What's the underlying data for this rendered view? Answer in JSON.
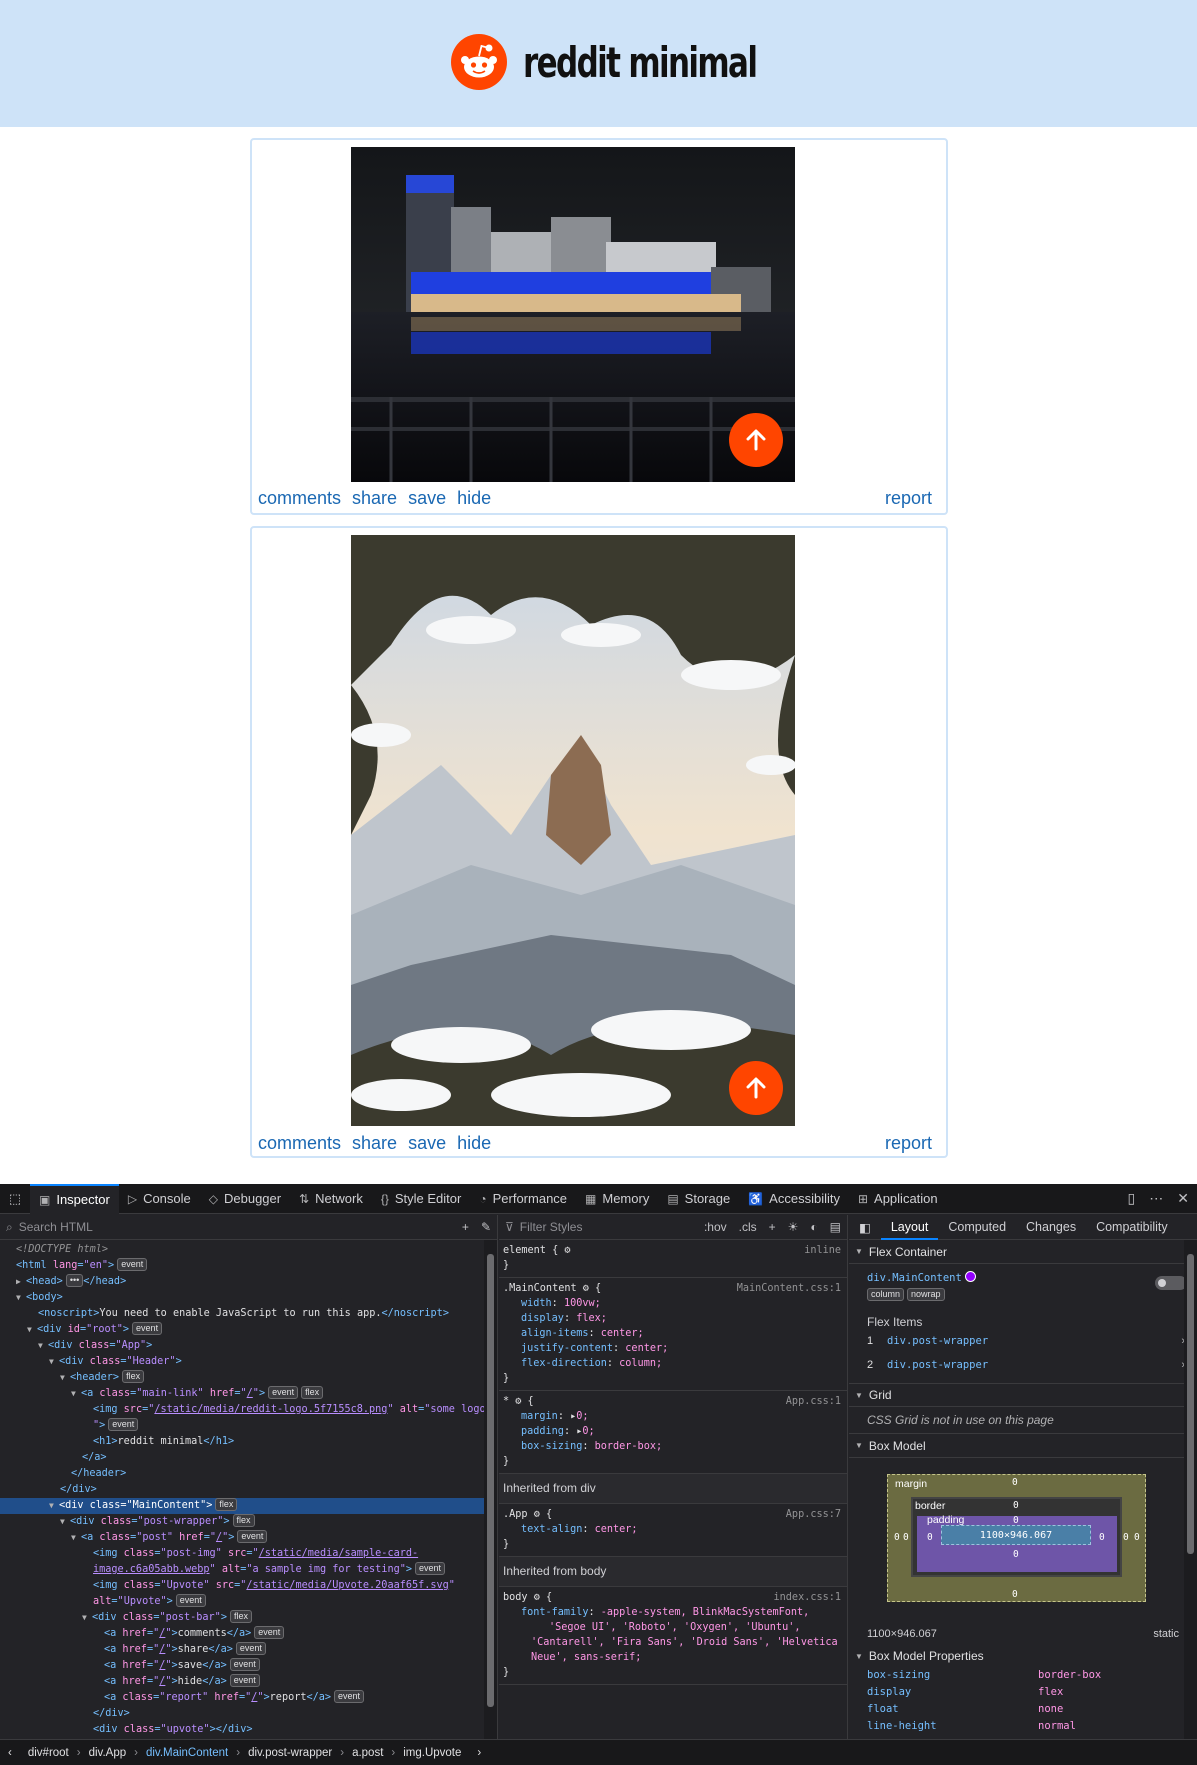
{
  "site": {
    "title": "reddit minimal"
  },
  "posts": [
    {
      "bar": {
        "comments": "comments",
        "share": "share",
        "save": "save",
        "hide": "hide",
        "report": "report"
      }
    },
    {
      "bar": {
        "comments": "comments",
        "share": "share",
        "save": "save",
        "hide": "hide",
        "report": "report"
      }
    }
  ],
  "devtools": {
    "tabs": [
      "Inspector",
      "Console",
      "Debugger",
      "Network",
      "Style Editor",
      "Performance",
      "Memory",
      "Storage",
      "Accessibility",
      "Application"
    ],
    "search_placeholder": "Search HTML",
    "filter_placeholder": "Filter Styles",
    "filter_tools": [
      ":hov",
      ".cls"
    ],
    "html_tree": {
      "doctype": "<!DOCTYPE html>",
      "noscript_text": "You need to enable JavaScript to run this app.",
      "img_logo_src": "/static/media/reddit-logo.5f7155c8.png",
      "img_logo_alt": "some logo",
      "h1_text": "reddit minimal",
      "post_img_src": "/static/media/sample-card-image.c6a05abb.webp",
      "post_img_alt": "a sample img for testing",
      "upvote_src": "/static/media/Upvote.20aaf65f.svg",
      "upvote_alt": "Upvote",
      "links": [
        "comments",
        "share",
        "save",
        "hide"
      ],
      "report": "report"
    },
    "rules": {
      "element": {
        "selector": "element {",
        "src": "inline"
      },
      "main_content": {
        "selector": ".MainContent",
        "src": "MainContent.css:1",
        "decls": [
          {
            "p": "width",
            "v": "100vw;"
          },
          {
            "p": "display",
            "v": "flex;"
          },
          {
            "p": "align-items",
            "v": "center;"
          },
          {
            "p": "justify-content",
            "v": "center;"
          },
          {
            "p": "flex-direction",
            "v": "column;"
          }
        ]
      },
      "star": {
        "selector": "*",
        "src": "App.css:1",
        "decls": [
          {
            "p": "margin",
            "v": "0;"
          },
          {
            "p": "padding",
            "v": "0;"
          },
          {
            "p": "box-sizing",
            "v": "border-box;"
          }
        ]
      },
      "inherited_div": "Inherited from div",
      "app": {
        "selector": ".App",
        "src": "App.css:7",
        "decls": [
          {
            "p": "text-align",
            "v": "center;"
          }
        ]
      },
      "inherited_body": "Inherited from body",
      "body": {
        "selector": "body",
        "src": "index.css:1",
        "font_family_prop": "font-family",
        "font_family_val": "-apple-system, BlinkMacSystemFont,",
        "font_family_val2": "'Segoe UI', 'Roboto', 'Oxygen', 'Ubuntu',",
        "font_family_val3": "'Cantarell', 'Fira Sans', 'Droid Sans', 'Helvetica",
        "font_family_val4": "Neue', sans-serif;"
      }
    },
    "layout": {
      "tabs": [
        "Layout",
        "Computed",
        "Changes",
        "Compatibility"
      ],
      "flex_container": "Flex Container",
      "container_name": "div.MainContent",
      "container_badges": [
        "column",
        "nowrap"
      ],
      "flex_items_title": "Flex Items",
      "flex_items": [
        {
          "n": "1",
          "name": "div.post-wrapper"
        },
        {
          "n": "2",
          "name": "div.post-wrapper"
        }
      ],
      "grid": "Grid",
      "grid_msg": "CSS Grid is not in use on this page",
      "box_model": "Box Model",
      "bm_labels": {
        "margin": "margin",
        "border": "border",
        "padding": "padding"
      },
      "content_size": "1100×946.067",
      "size_line": "1100×946.067",
      "position": "static",
      "bm_props_title": "Box Model Properties",
      "bm_props": [
        {
          "k": "box-sizing",
          "v": "border-box"
        },
        {
          "k": "display",
          "v": "flex"
        },
        {
          "k": "float",
          "v": "none"
        },
        {
          "k": "line-height",
          "v": "normal"
        }
      ]
    },
    "breadcrumbs": [
      "div#root",
      "div.App",
      "div.MainContent",
      "div.post-wrapper",
      "a.post",
      "img.Upvote"
    ]
  }
}
